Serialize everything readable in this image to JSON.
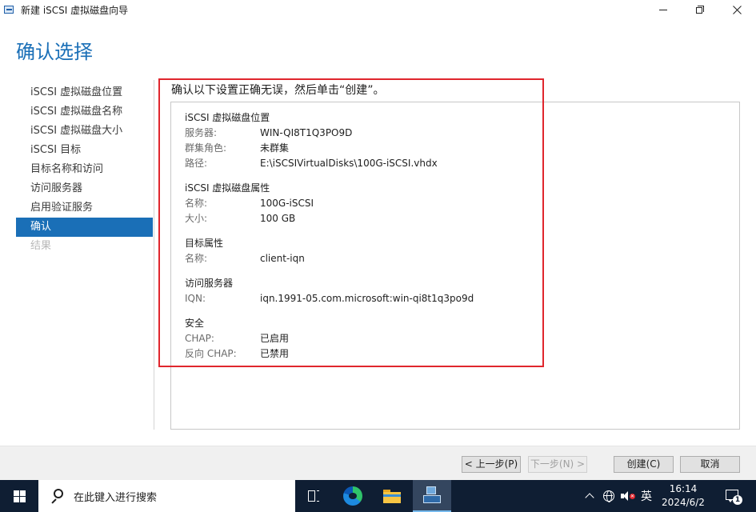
{
  "window": {
    "title": "新建 iSCSI 虚拟磁盘向导"
  },
  "page": {
    "title": "确认选择",
    "instruction": "确认以下设置正确无误，然后单击“创建”。"
  },
  "nav": {
    "items": [
      {
        "label": "iSCSI 虚拟磁盘位置",
        "state": "normal"
      },
      {
        "label": "iSCSI 虚拟磁盘名称",
        "state": "normal"
      },
      {
        "label": "iSCSI 虚拟磁盘大小",
        "state": "normal"
      },
      {
        "label": "iSCSI 目标",
        "state": "normal"
      },
      {
        "label": "目标名称和访问",
        "state": "normal"
      },
      {
        "label": "访问服务器",
        "state": "normal"
      },
      {
        "label": "启用验证服务",
        "state": "normal"
      },
      {
        "label": "确认",
        "state": "active"
      },
      {
        "label": "结果",
        "state": "disabled"
      }
    ]
  },
  "summary": {
    "sections": [
      {
        "title": "iSCSI 虚拟磁盘位置",
        "rows": [
          {
            "key": "服务器:",
            "value": "WIN-QI8T1Q3PO9D"
          },
          {
            "key": "群集角色:",
            "value": "未群集"
          },
          {
            "key": "路径:",
            "value": "E:\\iSCSIVirtualDisks\\100G-iSCSI.vhdx"
          }
        ]
      },
      {
        "title": "iSCSI 虚拟磁盘属性",
        "rows": [
          {
            "key": "名称:",
            "value": "100G-iSCSI"
          },
          {
            "key": "大小:",
            "value": "100 GB"
          }
        ]
      },
      {
        "title": "目标属性",
        "rows": [
          {
            "key": "名称:",
            "value": "client-iqn"
          }
        ]
      },
      {
        "title": "访问服务器",
        "rows": [
          {
            "key": "IQN:",
            "value": "iqn.1991-05.com.microsoft:win-qi8t1q3po9d"
          }
        ]
      },
      {
        "title": "安全",
        "rows": [
          {
            "key": "CHAP:",
            "value": "已启用"
          },
          {
            "key": "反向 CHAP:",
            "value": "已禁用"
          }
        ]
      }
    ]
  },
  "buttons": {
    "prev": "< 上一步(P)",
    "next": "下一步(N) >",
    "create": "创建(C)",
    "cancel": "取消"
  },
  "taskbar": {
    "search_placeholder": "在此键入进行搜索",
    "ime": "英",
    "time": "16:14",
    "date": "2024/6/2",
    "notification_count": "1"
  },
  "colors": {
    "accent": "#1a6fb7",
    "highlight_border": "#e0262d",
    "taskbar": "#0f1e33"
  }
}
